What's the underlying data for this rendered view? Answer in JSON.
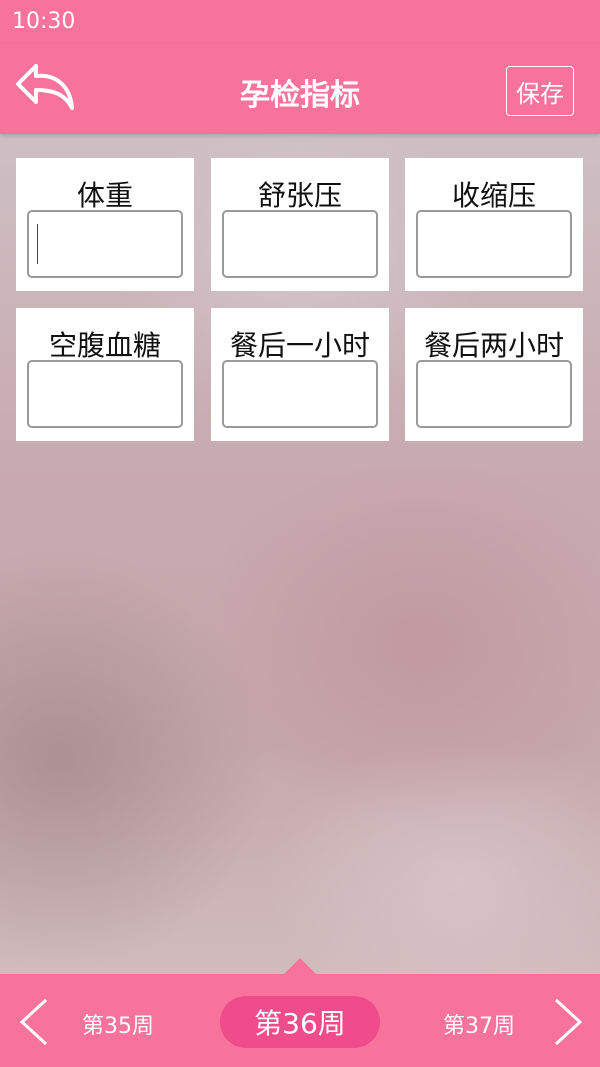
{
  "status_bar": {
    "time": "10:30"
  },
  "header": {
    "title": "孕检指标",
    "save_label": "保存"
  },
  "metrics": [
    {
      "label": "体重",
      "value": ""
    },
    {
      "label": "舒张压",
      "value": ""
    },
    {
      "label": "收缩压",
      "value": ""
    },
    {
      "label": "空腹血糖",
      "value": ""
    },
    {
      "label": "餐后一小时",
      "value": ""
    },
    {
      "label": "餐后两小时",
      "value": ""
    }
  ],
  "week_nav": {
    "prev": "第35周",
    "current": "第36周",
    "next": "第37周"
  },
  "colors": {
    "brand": "#f7739b",
    "active_pill": "#f04b8a"
  },
  "icons": {
    "back": "curved-back-arrow-icon",
    "prev": "chevron-left-icon",
    "next": "chevron-right-icon"
  }
}
